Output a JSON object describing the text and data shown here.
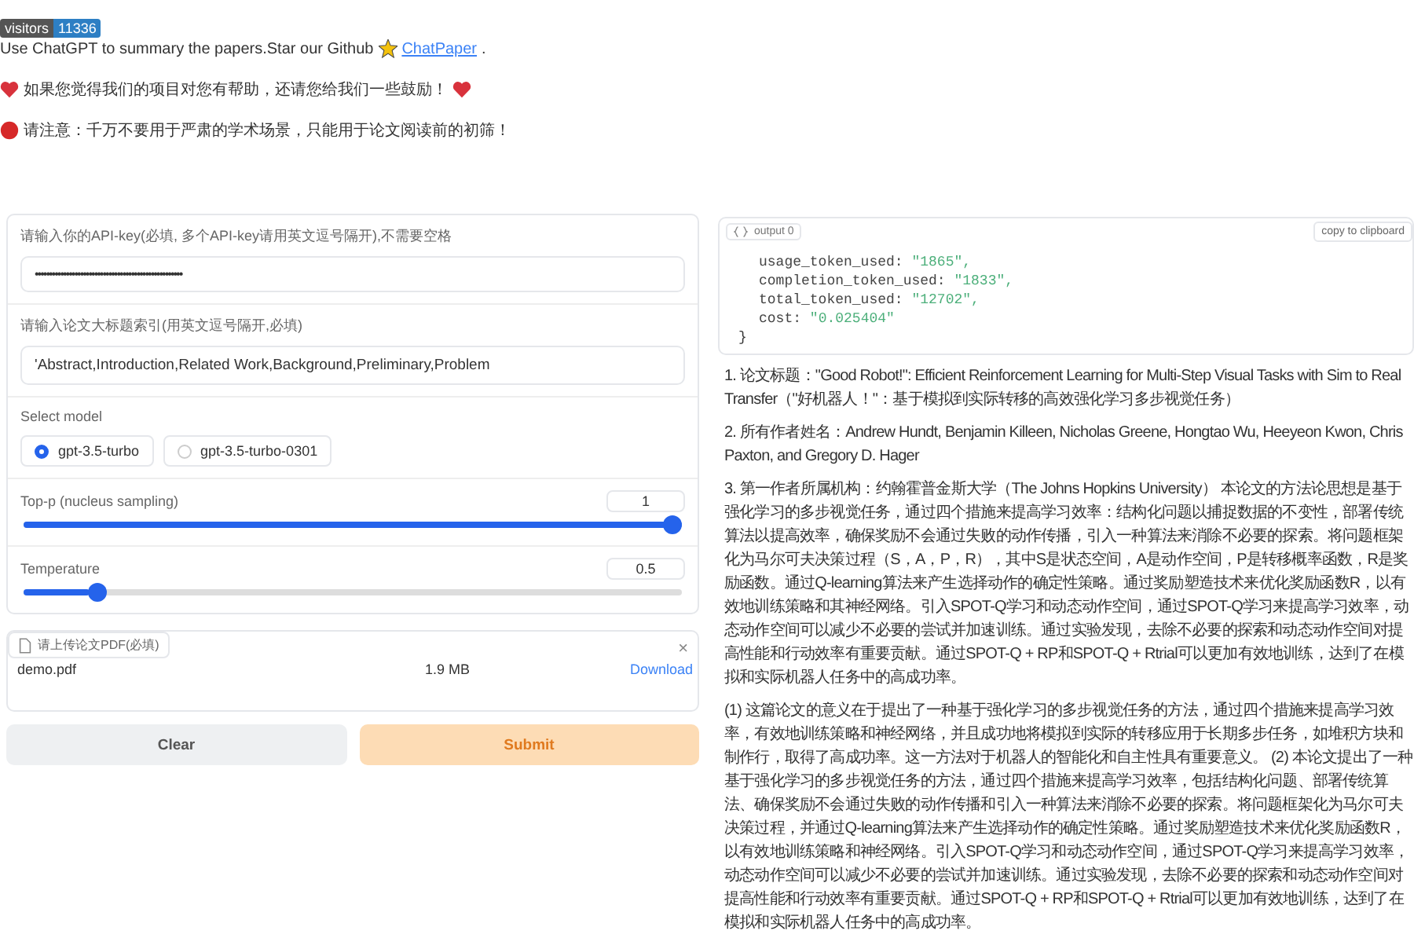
{
  "badge": {
    "label": "visitors",
    "count": "11336"
  },
  "intro": {
    "text": "Use ChatGPT to summary the papers.Star our Github",
    "link": "ChatPaper",
    "after": "."
  },
  "notes": [
    {
      "kind": "heart",
      "text": "如果您觉得我们的项目对您有帮助，还请您给我们一些鼓励！",
      "trailing_heart": true
    },
    {
      "kind": "warning",
      "text": "请注意：千万不要用于严肃的学术场景，只能用于论文阅读前的初筛！",
      "trailing_heart": false
    }
  ],
  "api_key": {
    "label": "请输入你的API-key(必填, 多个API-key请用英文逗号隔开),不需要空格",
    "value": "••••••••••••••••••••••••••••••••••••••••••••••••••••"
  },
  "sections_field": {
    "label": "请输入论文大标题索引(用英文逗号隔开,必填)",
    "value": "'Abstract,Introduction,Related Work,Background,Preliminary,Problem"
  },
  "model": {
    "label": "Select model",
    "options": [
      {
        "label": "gpt-3.5-turbo",
        "selected": true
      },
      {
        "label": "gpt-3.5-turbo-0301",
        "selected": false
      }
    ]
  },
  "sliders": [
    {
      "label": "Top-p (nucleus sampling)",
      "value": "1",
      "level": 1.0
    },
    {
      "label": "Temperature",
      "value": "0.5",
      "level": 0.1
    }
  ],
  "upload": {
    "label": "请上传论文PDF(必填)",
    "close": "×",
    "file": "demo.pdf",
    "size": "1.9 MB",
    "download": "Download"
  },
  "buttons": [
    {
      "kind": "secondary",
      "label": "Clear"
    },
    {
      "kind": "primary",
      "label": "Submit"
    }
  ],
  "output": {
    "tab": "output 0",
    "copy": "copy to clipboard",
    "close_brace": "}",
    "entries": [
      {
        "key": "usage_token_used:",
        "value": "\"1865\","
      },
      {
        "key": "completion_token_used:",
        "value": "\"1833\","
      },
      {
        "key": "total_token_used:",
        "value": "\"12702\","
      },
      {
        "key": "cost:",
        "value": "\"0.025404\""
      }
    ]
  },
  "summary": [
    "1. 论文标题：\"Good Robot!\": Efficient Reinforcement Learning for Multi-Step Visual Tasks with Sim to Real Transfer（\"好机器人！\"：基于模拟到实际转移的高效强化学习多步视觉任务）",
    "2. 所有作者姓名：Andrew Hundt, Benjamin Killeen, Nicholas Greene, Hongtao Wu, Heeyeon Kwon, Chris Paxton, and Gregory D. Hager",
    "3. 第一作者所属机构：约翰霍普金斯大学（The Johns Hopkins University） 本论文的方法论思想是基于强化学习的多步视觉任务，通过四个措施来提高学习效率：结构化问题以捕捉数据的不变性，部署传统算法以提高效率，确保奖励不会通过失败的动作传播，引入一种算法来消除不必要的探索。将问题框架化为马尔可夫决策过程（S，A，P，R），其中S是状态空间，A是动作空间，P是转移概率函数，R是奖励函数。通过Q-learning算法来产生选择动作的确定性策略。通过奖励塑造技术来优化奖励函数R，以有效地训练策略和其神经网络。引入SPOT-Q学习和动态动作空间，通过SPOT-Q学习来提高学习效率，动态动作空间可以减少不必要的尝试并加速训练。通过实验发现，去除不必要的探索和动态动作空间对提高性能和行动效率有重要贡献。通过SPOT-Q + RP和SPOT-Q + Rtrial可以更加有效地训练，达到了在模拟和实际机器人任务中的高成功率。",
    "(1) 这篇论文的意义在于提出了一种基于强化学习的多步视觉任务的方法，通过四个措施来提高学习效率，有效地训练策略和神经网络，并且成功地将模拟到实际的转移应用于长期多步任务，如堆积方块和制作行，取得了高成功率。这一方法对于机器人的智能化和自主性具有重要意义。 (2) 本论文提出了一种基于强化学习的多步视觉任务的方法，通过四个措施来提高学习效率，包括结构化问题、部署传统算法、确保奖励不会通过失败的动作传播和引入一种算法来消除不必要的探索。将问题框架化为马尔可夫决策过程，并通过Q-learning算法来产生选择动作的确定性策略。通过奖励塑造技术来优化奖励函数R，以有效地训练策略和神经网络。引入SPOT-Q学习和动态动作空间，通过SPOT-Q学习来提高学习效率，动态动作空间可以减少不必要的尝试并加速训练。通过实验发现，去除不必要的探索和动态动作空间对提高性能和行动效率有重要贡献。通过SPOT-Q + RP和SPOT-Q + Rtrial可以更加有效地训练，达到了在模拟和实际机器人任务中的高成功率。"
  ]
}
